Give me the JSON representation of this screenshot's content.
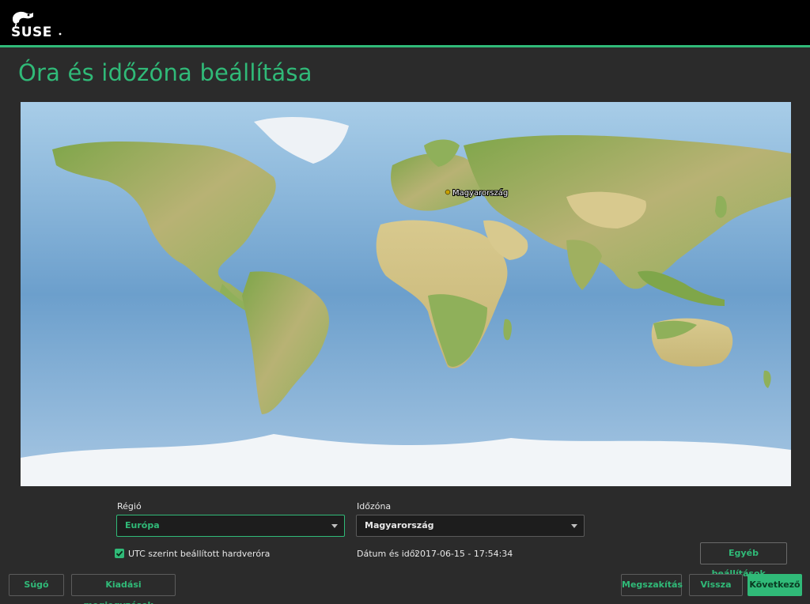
{
  "header": {
    "logo_text": "SUSE",
    "accent_color": "#30ba78",
    "background_color": "#000000"
  },
  "page": {
    "title": "Óra és időzóna beállítása"
  },
  "map": {
    "selected_marker_label": "Magyarország"
  },
  "region": {
    "label": "Régió",
    "value": "Európa"
  },
  "timezone": {
    "label": "Időzóna",
    "value": "Magyarország"
  },
  "hwclock": {
    "label": "UTC szerint beállított hardveróra",
    "checked": true
  },
  "datetime": {
    "label": "Dátum és idő:",
    "value": "2017-06-15 - 17:54:34"
  },
  "buttons": {
    "other_settings": "Egyéb beállítások...",
    "help": "Súgó",
    "release_notes": "Kiadási megjegyzések...",
    "abort": "Megszakítás",
    "back": "Vissza",
    "next": "Következő"
  }
}
